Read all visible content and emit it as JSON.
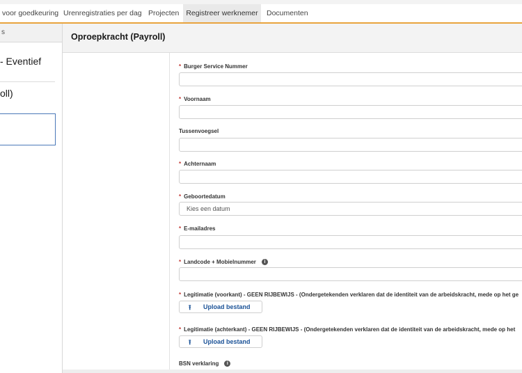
{
  "tabs": [
    {
      "label": "voor goedkeuring",
      "active": false
    },
    {
      "label": "Urenregistraties per dag",
      "active": false
    },
    {
      "label": "Projecten",
      "active": false
    },
    {
      "label": "Registreer werknemer",
      "active": true
    },
    {
      "label": "Documenten",
      "active": false
    }
  ],
  "sidebar": {
    "header": "s",
    "items": [
      {
        "label": "- Eventief"
      },
      {
        "label": "oll)"
      }
    ]
  },
  "main": {
    "title": "Oproepkracht (Payroll)"
  },
  "form": {
    "required_marker": "*",
    "fields": [
      {
        "label": "Burger Service Nummer",
        "required": true,
        "placeholder": ""
      },
      {
        "label": "Voornaam",
        "required": true,
        "placeholder": ""
      },
      {
        "label": "Tussenvoegsel",
        "required": false,
        "placeholder": ""
      },
      {
        "label": "Achternaam",
        "required": true,
        "placeholder": ""
      },
      {
        "label": "Geboortedatum",
        "required": true,
        "placeholder": "Kies een datum"
      },
      {
        "label": "E-mailadres",
        "required": true,
        "placeholder": ""
      },
      {
        "label": "Landcode + Mobielnummer",
        "required": true,
        "placeholder": "",
        "info": "i"
      }
    ],
    "uploads": [
      {
        "label": "Legitimatie (voorkant) - GEEN RIJBEWIJS - (Ondergetekenden verklaren dat de identiteit van de arbeidskracht, mede op het ge",
        "button": "Upload bestand"
      },
      {
        "label": "Legitimatie (achterkant) - GEEN RIJBEWIJS - (Ondergetekenden verklaren dat de identiteit van de arbeidskracht, mede op het",
        "button": "Upload bestand"
      }
    ],
    "bsn_label": "BSN verklaring",
    "bsn_info": "i",
    "upload_icon": "upload-icon",
    "info_icon": "info-icon"
  },
  "colors": {
    "accent": "#e8a33d",
    "link": "#1b5297",
    "required": "#c23934",
    "selected_border": "#4a78b8"
  }
}
